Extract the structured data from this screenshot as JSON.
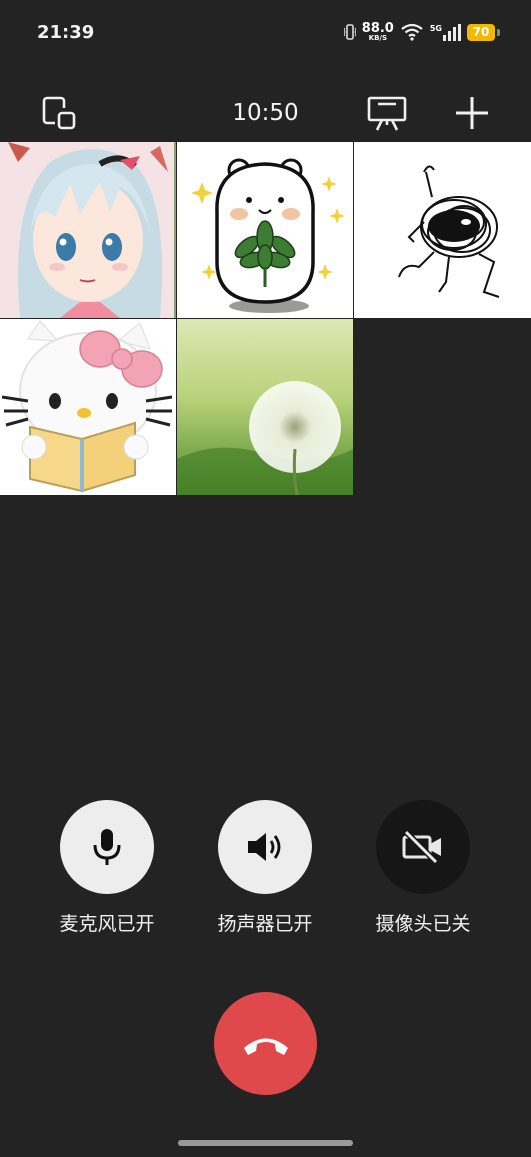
{
  "status_bar": {
    "time": "21:39",
    "net_speed": "88.0",
    "net_speed_unit": "KB/S",
    "network_type": "5G",
    "battery": "70",
    "battery_color": "#f5b800"
  },
  "call": {
    "duration": "10:50",
    "icons": {
      "minimize": "picture-in-picture-icon",
      "screen_share": "screen-share-icon",
      "add": "add-participant-icon"
    }
  },
  "participants": [
    {
      "avatar": "anime-girl-avatar"
    },
    {
      "avatar": "bear-with-leaves-avatar"
    },
    {
      "avatar": "scribble-doodle-avatar"
    },
    {
      "avatar": "hello-kitty-reading-avatar"
    },
    {
      "avatar": "dandelion-avatar"
    }
  ],
  "controls": {
    "microphone_label": "麦克风已开",
    "speaker_label": "扬声器已开",
    "camera_label": "摄像头已关"
  },
  "colors": {
    "background": "#232323",
    "control_on": "#ededed",
    "control_off": "#161616",
    "hangup": "#e0494b"
  }
}
